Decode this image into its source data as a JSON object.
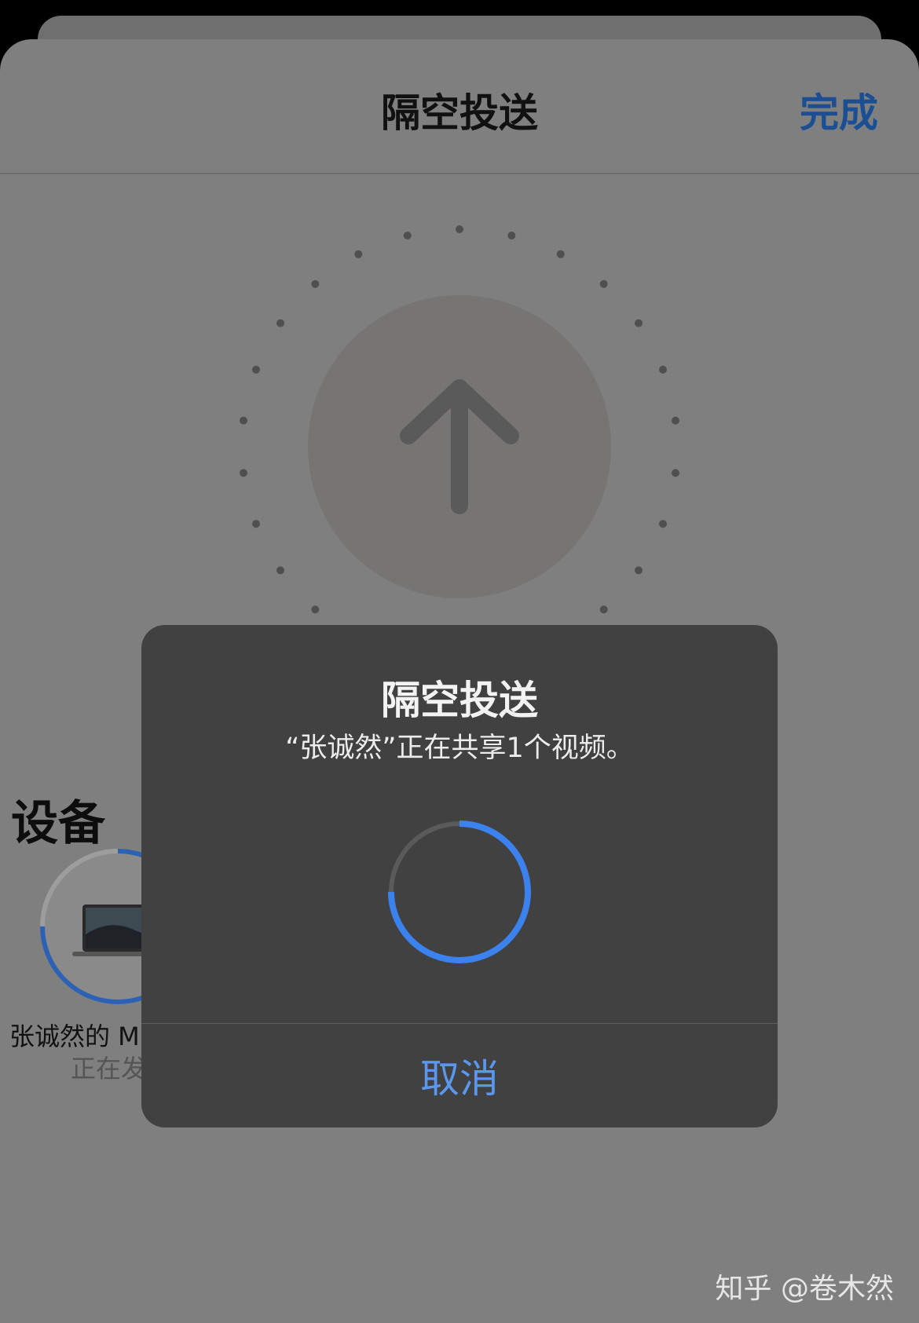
{
  "sheet": {
    "title": "隔空投送",
    "done_label": "完成"
  },
  "devices": {
    "heading": "设备",
    "items": [
      {
        "name": "张诚然的 M",
        "status": "正在发",
        "progress": 0.75
      }
    ]
  },
  "alert": {
    "title": "隔空投送",
    "message": "“张诚然”正在共享1个视频。",
    "progress": 0.75,
    "cancel_label": "取消"
  },
  "watermark": "知乎 @卷木然",
  "colors": {
    "accent_blue": "#3b82ee",
    "done_blue": "#1c4e93",
    "cancel_blue": "#5b97ee",
    "sheet_gray": "#7f7f7f",
    "alert_gray": "#414141"
  },
  "icons": [
    "upload-arrow-icon",
    "laptop-icon",
    "progress-ring-icon"
  ]
}
